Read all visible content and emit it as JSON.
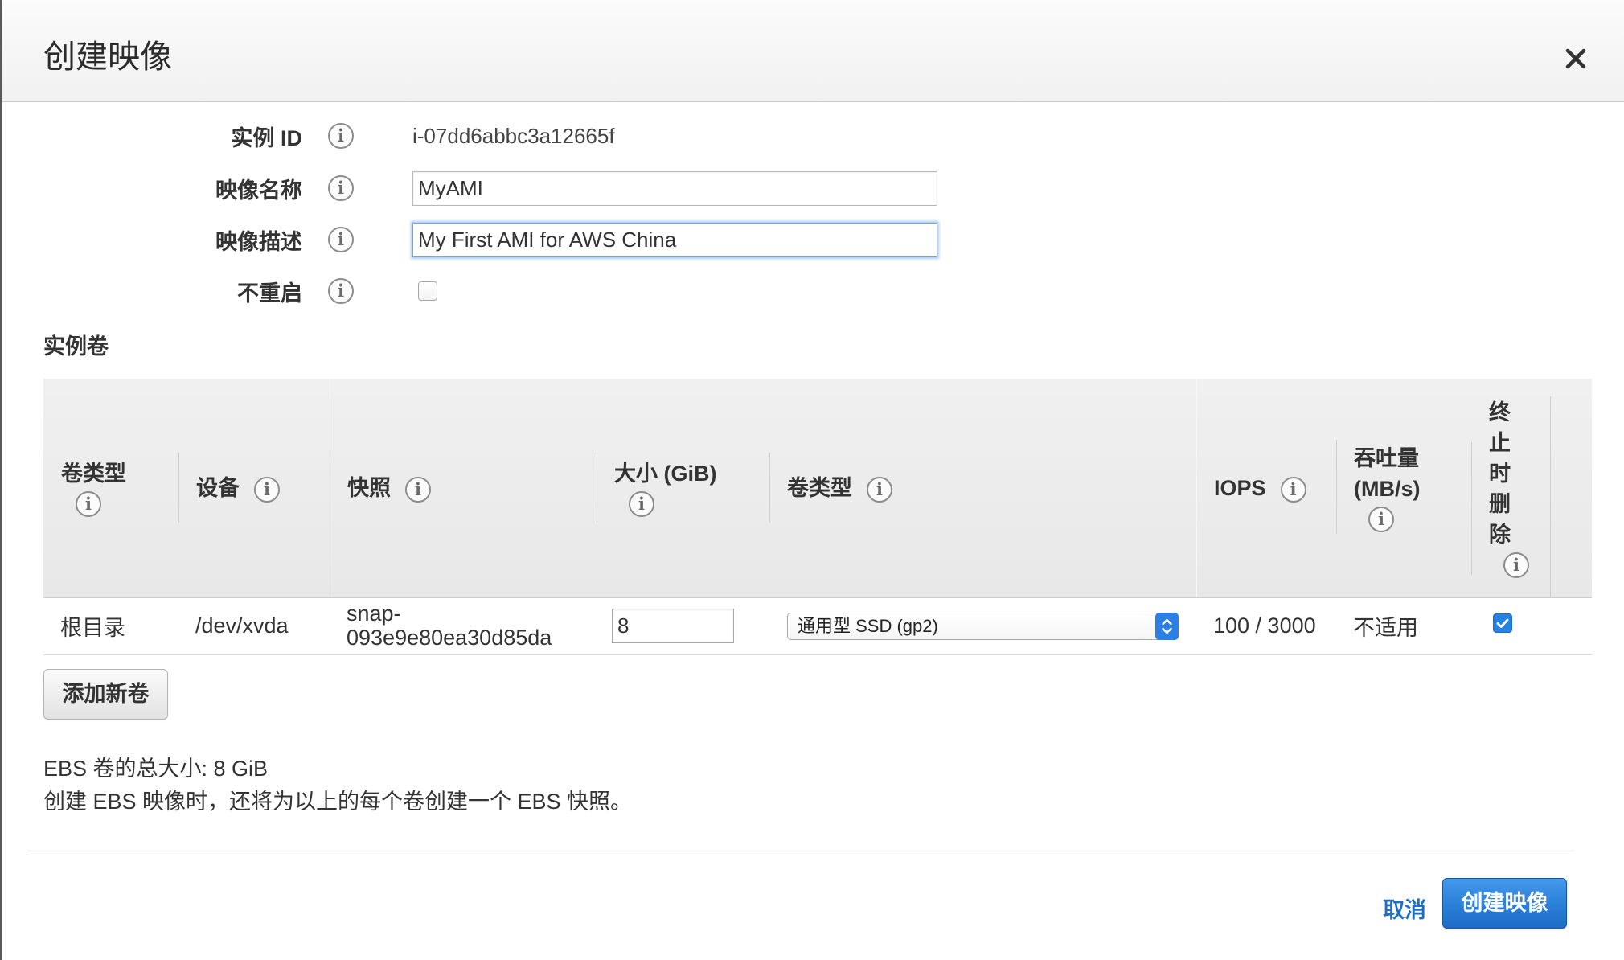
{
  "dialog": {
    "title": "创建映像"
  },
  "form": {
    "instance_id": {
      "label": "实例 ID",
      "value": "i-07dd6abbc3a12665f"
    },
    "image_name": {
      "label": "映像名称",
      "value": "MyAMI"
    },
    "image_description": {
      "label": "映像描述",
      "value": "My First AMI for AWS China"
    },
    "no_reboot": {
      "label": "不重启",
      "checked": false
    }
  },
  "volumes": {
    "section_title": "实例卷",
    "columns": [
      "卷类型",
      "设备",
      "快照",
      "大小 (GiB)",
      "卷类型",
      "IOPS",
      "吞吐量 (MB/s)",
      "终止时删除"
    ],
    "rows": [
      {
        "volume_type": "根目录",
        "device": "/dev/xvda",
        "snapshot": "snap-093e9e80ea30d85da",
        "size": "8",
        "type_selected": "通用型 SSD (gp2)",
        "iops": "100 / 3000",
        "throughput": "不适用",
        "delete_on_termination": true
      }
    ],
    "add_button": "添加新卷"
  },
  "summary": {
    "total_size": "EBS 卷的总大小: 8 GiB",
    "snapshot_note": "创建 EBS 映像时，还将为以上的每个卷创建一个 EBS 快照。"
  },
  "footer": {
    "cancel_label": "取消",
    "create_label": "创建映像"
  },
  "icons": {
    "close": "close-icon",
    "info": "info-icon",
    "select_arrows": "up-down-chevron-icon",
    "check": "checkmark-icon"
  },
  "colors": {
    "primary": "#2a7fd8",
    "link": "#1d6fc3",
    "checkbox_checked": "#2683e3",
    "focus_ring": "#6fa9e4"
  }
}
